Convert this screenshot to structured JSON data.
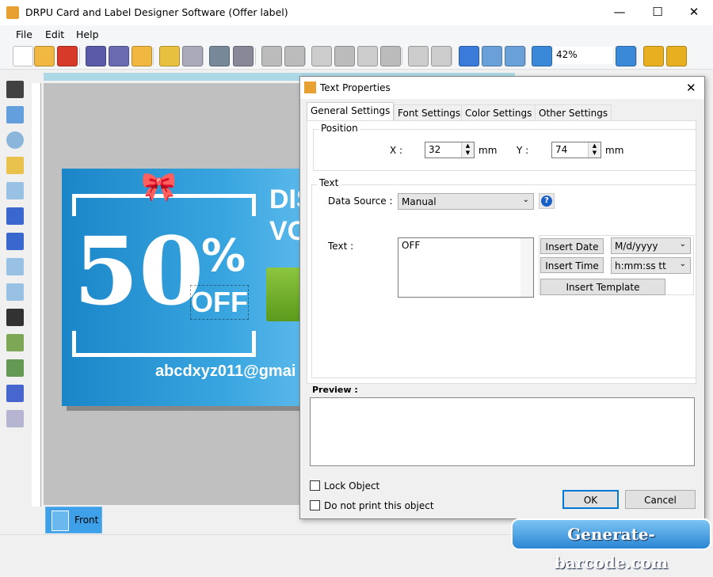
{
  "window": {
    "title": "DRPU Card and Label Designer Software (Offer label)",
    "minimize": "—",
    "maximize": "☐",
    "close": "✕"
  },
  "menu": [
    "File",
    "Edit",
    "Help"
  ],
  "toolbar": {
    "zoom": "42%",
    "icons": [
      "new-icon",
      "open-icon",
      "close-file-icon",
      "save-icon",
      "save-as-icon",
      "export-icon",
      "edit-icon",
      "print-icon",
      "database-add-icon",
      "database-icon",
      "undo-icon",
      "redo-icon",
      "copy-icon",
      "cut-icon",
      "paste-icon",
      "delete-icon",
      "bring-front-icon",
      "send-back-icon",
      "grid-icon",
      "center-icon",
      "fit-icon",
      "zoom-in-icon",
      "zoom-out-icon",
      "lock-icon",
      "unlock-icon"
    ]
  },
  "toolbox": [
    "select-icon",
    "line-icon",
    "ellipse-icon",
    "pencil-icon",
    "rectangle-icon",
    "text-icon",
    "curve-icon",
    "star-icon",
    "triangle-icon",
    "barcode-icon",
    "image-icon",
    "image-library-icon",
    "wordart-icon",
    "pattern-icon"
  ],
  "card": {
    "big": "50",
    "percent": "%",
    "off": "OFF",
    "heading1": "DIS",
    "heading2": "VO",
    "email": "abcdxyz011@gmai"
  },
  "bottom_tab": "Front",
  "dialog": {
    "title": "Text Properties",
    "close": "✕",
    "tabs": [
      "General Settings",
      "Font Settings",
      "Color Settings",
      "Other Settings"
    ],
    "position": {
      "label": "Position",
      "x_label": "X :",
      "x": "32",
      "y_label": "Y :",
      "y": "74",
      "unit": "mm"
    },
    "text_group": {
      "label": "Text",
      "data_source_label": "Data Source :",
      "data_source": "Manual",
      "text_label": "Text :",
      "text": "OFF",
      "insert_date": "Insert Date",
      "date_format": "M/d/yyyy",
      "insert_time": "Insert Time",
      "time_format": "h:mm:ss tt",
      "insert_template": "Insert Template"
    },
    "preview_label": "Preview :",
    "lock_object": "Lock Object",
    "no_print": "Do not print this object",
    "ok": "OK",
    "cancel": "Cancel"
  },
  "watermark": "Generate-barcode.com"
}
